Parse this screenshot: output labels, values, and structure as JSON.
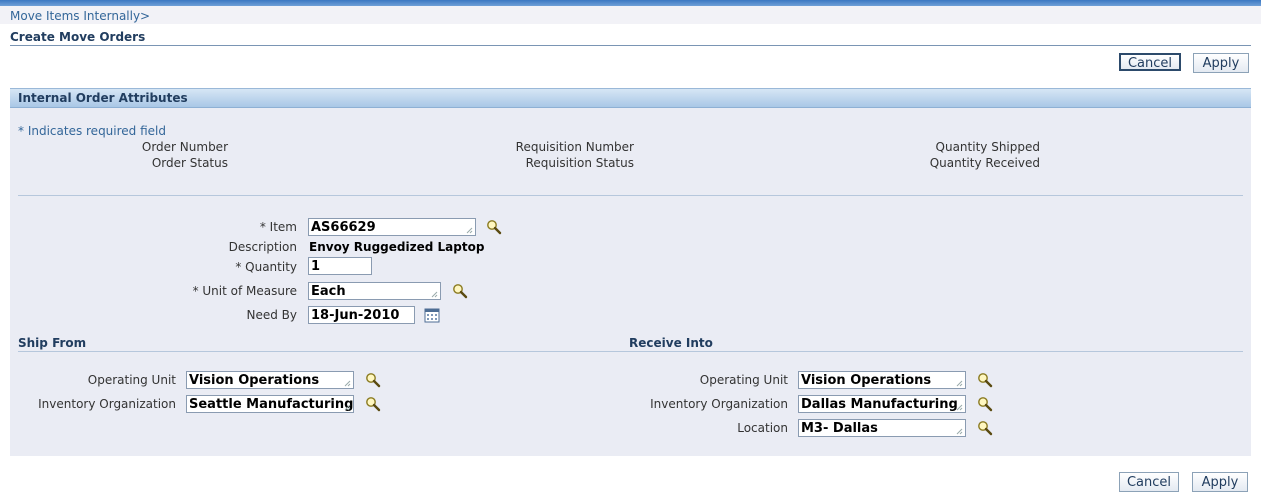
{
  "breadcrumb": {
    "link": "Move Items Internally",
    "separator": ">"
  },
  "page": {
    "title": "Create Move Orders"
  },
  "buttons": {
    "cancel": "Cancel",
    "apply": "Apply"
  },
  "section": {
    "title": "Internal Order Attributes",
    "required_note": "* Indicates required field"
  },
  "readonly_fields": {
    "order_number": "Order Number",
    "order_status": "Order Status",
    "requisition_number": "Requisition Number",
    "requisition_status": "Requisition Status",
    "quantity_shipped": "Quantity Shipped",
    "quantity_received": "Quantity Received"
  },
  "form": {
    "item": {
      "label": "* Item",
      "value": "AS66629"
    },
    "description": {
      "label": "Description",
      "value": "Envoy Ruggedized Laptop"
    },
    "quantity": {
      "label": "* Quantity",
      "value": "1"
    },
    "uom": {
      "label": "* Unit of Measure",
      "value": "Each"
    },
    "need_by": {
      "label": "Need By",
      "value": "18-Jun-2010"
    }
  },
  "ship_from": {
    "title": "Ship From",
    "operating_unit": {
      "label": "Operating Unit",
      "value": "Vision Operations"
    },
    "inventory_org": {
      "label": "Inventory Organization",
      "value": "Seattle Manufacturing"
    }
  },
  "receive_into": {
    "title": "Receive Into",
    "operating_unit": {
      "label": "Operating Unit",
      "value": "Vision Operations"
    },
    "inventory_org": {
      "label": "Inventory Organization",
      "value": "Dallas Manufacturing"
    },
    "location": {
      "label": "Location",
      "value": "M3- Dallas"
    }
  },
  "colors": {
    "link": "#336699",
    "header_text": "#213d5f",
    "panel_bg": "#eaecf4",
    "section_header": "#a9c7e6"
  },
  "icons": {
    "lov": "search-icon",
    "calendar": "calendar-icon",
    "field_grip": "resize-grip-icon"
  }
}
